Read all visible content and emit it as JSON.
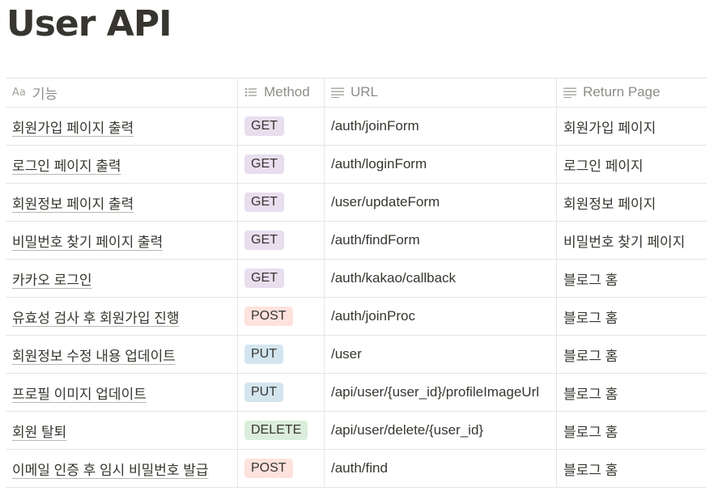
{
  "page": {
    "title": "User API"
  },
  "columns": {
    "name": "기능",
    "name_icon": "Aa",
    "method": "Method",
    "url": "URL",
    "return_page": "Return Page"
  },
  "colors": {
    "GET": "#e8deee",
    "POST": "#ffe2dd",
    "PUT": "#d3e5ef",
    "DELETE": "#dbeddb"
  },
  "rows": [
    {
      "name": "회원가입 페이지 출력",
      "method": "GET",
      "url": "/auth/joinForm",
      "return_page": "회원가입 페이지"
    },
    {
      "name": "로그인 페이지 출력",
      "method": "GET",
      "url": "/auth/loginForm",
      "return_page": "로그인 페이지"
    },
    {
      "name": "회원정보 페이지 출력",
      "method": "GET",
      "url": "/user/updateForm",
      "return_page": "회원정보 페이지"
    },
    {
      "name": "비밀번호 찾기 페이지 출력",
      "method": "GET",
      "url": "/auth/findForm",
      "return_page": "비밀번호 찾기 페이지"
    },
    {
      "name": "카카오 로그인",
      "method": "GET",
      "url": "/auth/kakao/callback",
      "return_page": "블로그 홈"
    },
    {
      "name": "유효성 검사 후 회원가입 진행",
      "method": "POST",
      "url": "/auth/joinProc",
      "return_page": "블로그 홈"
    },
    {
      "name": "회원정보 수정 내용 업데이트",
      "method": "PUT",
      "url": "/user",
      "return_page": "블로그 홈"
    },
    {
      "name": "프로필 이미지 업데이트",
      "method": "PUT",
      "url": "/api/user/{user_id}/profileImageUrl",
      "return_page": "블로그 홈"
    },
    {
      "name": "회원 탈퇴",
      "method": "DELETE",
      "url": "/api/user/delete/{user_id}",
      "return_page": "블로그 홈"
    },
    {
      "name": "이메일 인증 후 임시 비밀번호 발급",
      "method": "POST",
      "url": "/auth/find",
      "return_page": "블로그 홈"
    }
  ]
}
